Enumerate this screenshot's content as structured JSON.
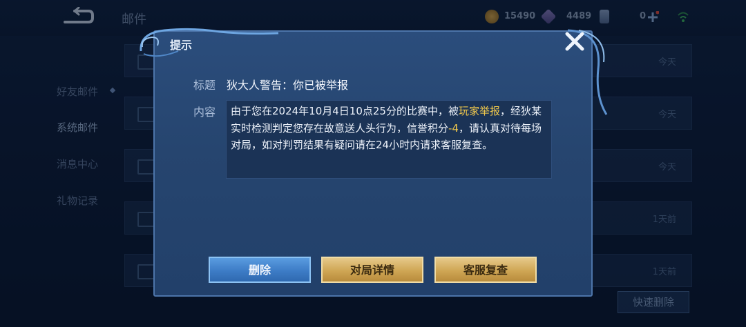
{
  "header": {
    "title": "邮件",
    "coins": "15490",
    "gems": "4489",
    "vouchers": "0",
    "back_icon": "back-arrow-icon",
    "coin_icon": "gold-coin-icon",
    "gem_icon": "diamond-icon",
    "voucher_icon": "voucher-icon",
    "add_icon": "plus-icon",
    "signal_icon": "wifi-icon"
  },
  "sidebar": {
    "items": [
      {
        "label": "好友邮件"
      },
      {
        "label": "系统邮件"
      },
      {
        "label": "消息中心"
      },
      {
        "label": "礼物记录"
      }
    ]
  },
  "mail_list": [
    {
      "time": "今天"
    },
    {
      "time": "今天"
    },
    {
      "time": "今天"
    },
    {
      "time": "1天前"
    },
    {
      "time": "1天前"
    }
  ],
  "quick_delete_label": "快速删除",
  "dialog": {
    "title": "提示",
    "subject_label": "标题",
    "subject": "狄大人警告：你已被举报",
    "content_label": "内容",
    "content_part1": "由于您在2024年10月4日10点25分的比赛中，被",
    "content_highlight1": "玩家举报",
    "content_part2": "，经狄某实时检测判定您存在故意送人头行为，信誉积分",
    "content_highlight2": "-4",
    "content_part3": "，请认真对待每场对局，如对判罚结果有疑问请在24小时内请求客服复查。",
    "buttons": {
      "delete": "删除",
      "match_details": "对局详情",
      "support_review": "客服复查"
    },
    "close_icon": "close-icon"
  },
  "colors": {
    "highlight": "#f2c94c",
    "dialog_bg": "#26456f",
    "blue_button": "#3d7cc6",
    "gold_button": "#cfa654"
  }
}
